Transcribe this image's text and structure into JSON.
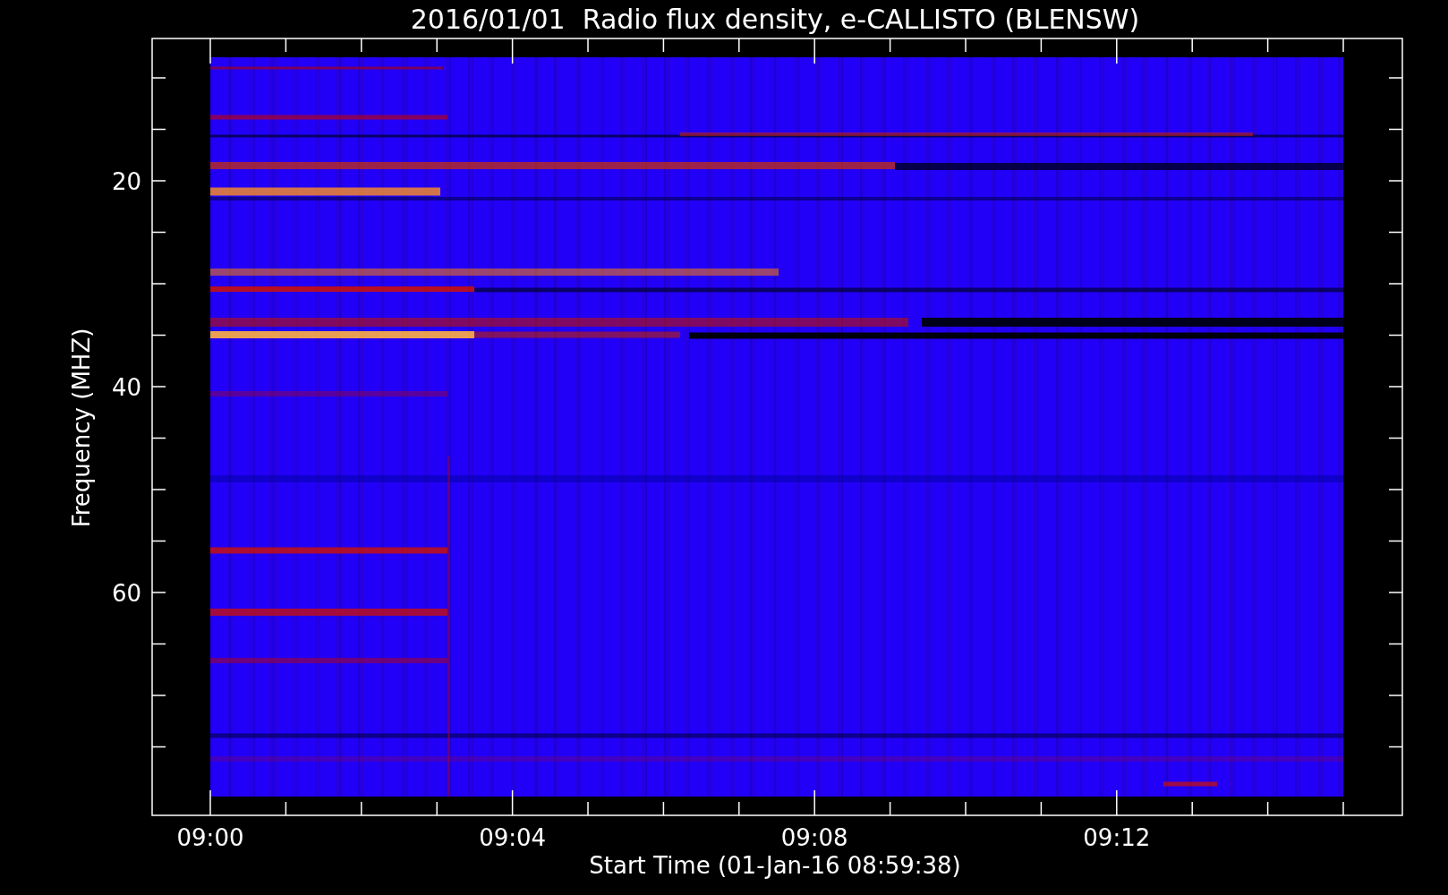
{
  "title": "2016/01/01  Radio flux density, e-CALLISTO (BLENSW)",
  "y_axis": {
    "label": "Frequency (MHZ)",
    "ticks": [
      "20",
      "40",
      "60"
    ]
  },
  "x_axis": {
    "label": "Start Time (01-Jan-16 08:59:38)",
    "ticks": [
      "09:00",
      "09:04",
      "09:08",
      "09:12"
    ]
  }
}
